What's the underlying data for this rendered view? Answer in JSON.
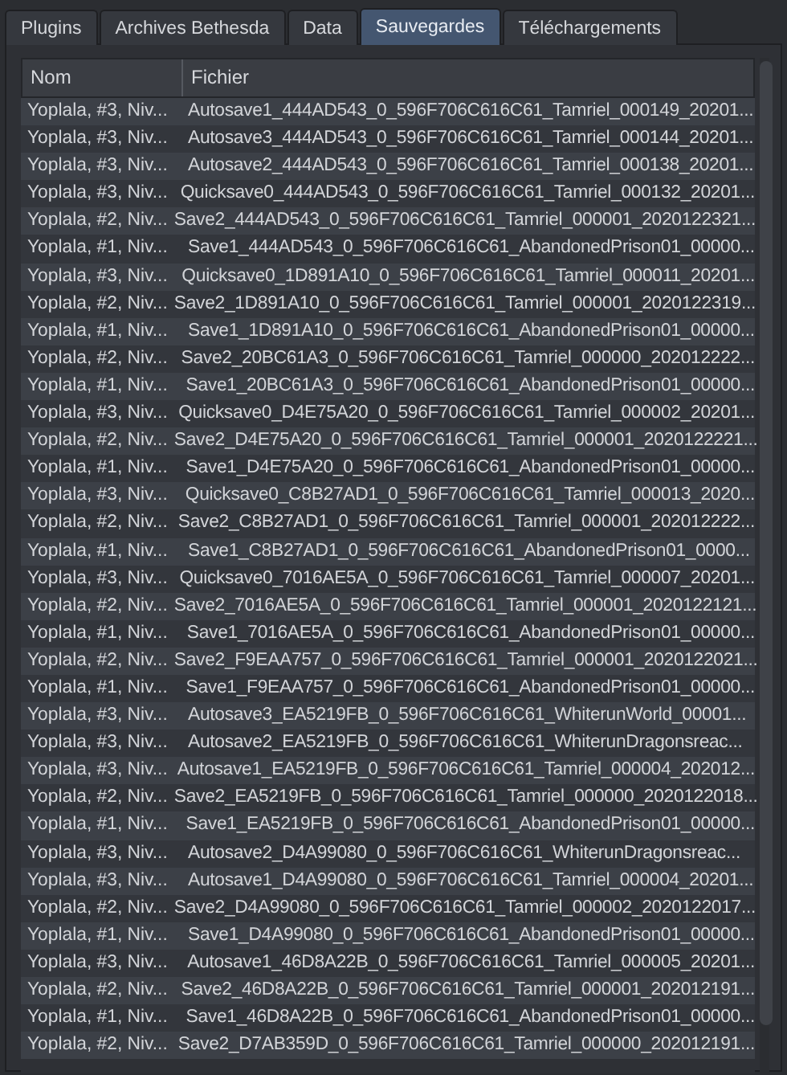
{
  "tabs": [
    {
      "label": "Plugins",
      "selected": false
    },
    {
      "label": "Archives Bethesda",
      "selected": false
    },
    {
      "label": "Data",
      "selected": false
    },
    {
      "label": "Sauvegardes",
      "selected": true
    },
    {
      "label": "Téléchargements",
      "selected": false
    }
  ],
  "table": {
    "columns": [
      "Nom",
      "Fichier"
    ],
    "rows": [
      [
        "Yoplala, #3, Niv...",
        "Autosave1_444AD543_0_596F706C616C61_Tamriel_000149_20201..."
      ],
      [
        "Yoplala, #3, Niv...",
        "Autosave3_444AD543_0_596F706C616C61_Tamriel_000144_20201..."
      ],
      [
        "Yoplala, #3, Niv...",
        "Autosave2_444AD543_0_596F706C616C61_Tamriel_000138_20201..."
      ],
      [
        "Yoplala, #3, Niv...",
        "Quicksave0_444AD543_0_596F706C616C61_Tamriel_000132_20201..."
      ],
      [
        "Yoplala, #2, Niv...",
        "Save2_444AD543_0_596F706C616C61_Tamriel_000001_2020122321..."
      ],
      [
        "Yoplala, #1, Niv...",
        "Save1_444AD543_0_596F706C616C61_AbandonedPrison01_00000..."
      ],
      [
        "Yoplala, #3, Niv...",
        "Quicksave0_1D891A10_0_596F706C616C61_Tamriel_000011_20201..."
      ],
      [
        "Yoplala, #2, Niv...",
        "Save2_1D891A10_0_596F706C616C61_Tamriel_000001_2020122319..."
      ],
      [
        "Yoplala, #1, Niv...",
        "Save1_1D891A10_0_596F706C616C61_AbandonedPrison01_00000..."
      ],
      [
        "Yoplala, #2, Niv...",
        "Save2_20BC61A3_0_596F706C616C61_Tamriel_000000_202012222..."
      ],
      [
        "Yoplala, #1, Niv...",
        "Save1_20BC61A3_0_596F706C616C61_AbandonedPrison01_00000..."
      ],
      [
        "Yoplala, #3, Niv...",
        "Quicksave0_D4E75A20_0_596F706C616C61_Tamriel_000002_20201..."
      ],
      [
        "Yoplala, #2, Niv...",
        "Save2_D4E75A20_0_596F706C616C61_Tamriel_000001_2020122221..."
      ],
      [
        "Yoplala, #1, Niv...",
        "Save1_D4E75A20_0_596F706C616C61_AbandonedPrison01_00000..."
      ],
      [
        "Yoplala, #3, Niv...",
        "Quicksave0_C8B27AD1_0_596F706C616C61_Tamriel_000013_2020..."
      ],
      [
        "Yoplala, #2, Niv...",
        "Save2_C8B27AD1_0_596F706C616C61_Tamriel_000001_202012222..."
      ],
      [
        "Yoplala, #1, Niv...",
        "Save1_C8B27AD1_0_596F706C616C61_AbandonedPrison01_0000..."
      ],
      [
        "Yoplala, #3, Niv...",
        "Quicksave0_7016AE5A_0_596F706C616C61_Tamriel_000007_20201..."
      ],
      [
        "Yoplala, #2, Niv...",
        "Save2_7016AE5A_0_596F706C616C61_Tamriel_000001_2020122121..."
      ],
      [
        "Yoplala, #1, Niv...",
        "Save1_7016AE5A_0_596F706C616C61_AbandonedPrison01_00000..."
      ],
      [
        "Yoplala, #2, Niv...",
        "Save2_F9EAA757_0_596F706C616C61_Tamriel_000001_2020122021..."
      ],
      [
        "Yoplala, #1, Niv...",
        "Save1_F9EAA757_0_596F706C616C61_AbandonedPrison01_00000..."
      ],
      [
        "Yoplala, #3, Niv...",
        "Autosave3_EA5219FB_0_596F706C616C61_WhiterunWorld_00001..."
      ],
      [
        "Yoplala, #3, Niv...",
        "Autosave2_EA5219FB_0_596F706C616C61_WhiterunDragonsreac..."
      ],
      [
        "Yoplala, #3, Niv...",
        "Autosave1_EA5219FB_0_596F706C616C61_Tamriel_000004_202012..."
      ],
      [
        "Yoplala, #2, Niv...",
        "Save2_EA5219FB_0_596F706C616C61_Tamriel_000000_2020122018..."
      ],
      [
        "Yoplala, #1, Niv...",
        "Save1_EA5219FB_0_596F706C616C61_AbandonedPrison01_00000..."
      ],
      [
        "Yoplala, #3, Niv...",
        "Autosave2_D4A99080_0_596F706C616C61_WhiterunDragonsreac..."
      ],
      [
        "Yoplala, #3, Niv...",
        "Autosave1_D4A99080_0_596F706C616C61_Tamriel_000004_20201..."
      ],
      [
        "Yoplala, #2, Niv...",
        "Save2_D4A99080_0_596F706C616C61_Tamriel_000002_2020122017..."
      ],
      [
        "Yoplala, #1, Niv...",
        "Save1_D4A99080_0_596F706C616C61_AbandonedPrison01_00000..."
      ],
      [
        "Yoplala, #3, Niv...",
        "Autosave1_46D8A22B_0_596F706C616C61_Tamriel_000005_20201..."
      ],
      [
        "Yoplala, #2, Niv...",
        "Save2_46D8A22B_0_596F706C616C61_Tamriel_000001_202012191..."
      ],
      [
        "Yoplala, #1, Niv...",
        "Save1_46D8A22B_0_596F706C616C61_AbandonedPrison01_00000..."
      ],
      [
        "Yoplala, #2, Niv...",
        "Save2_D7AB359D_0_596F706C616C61_Tamriel_000000_202012191..."
      ]
    ]
  }
}
